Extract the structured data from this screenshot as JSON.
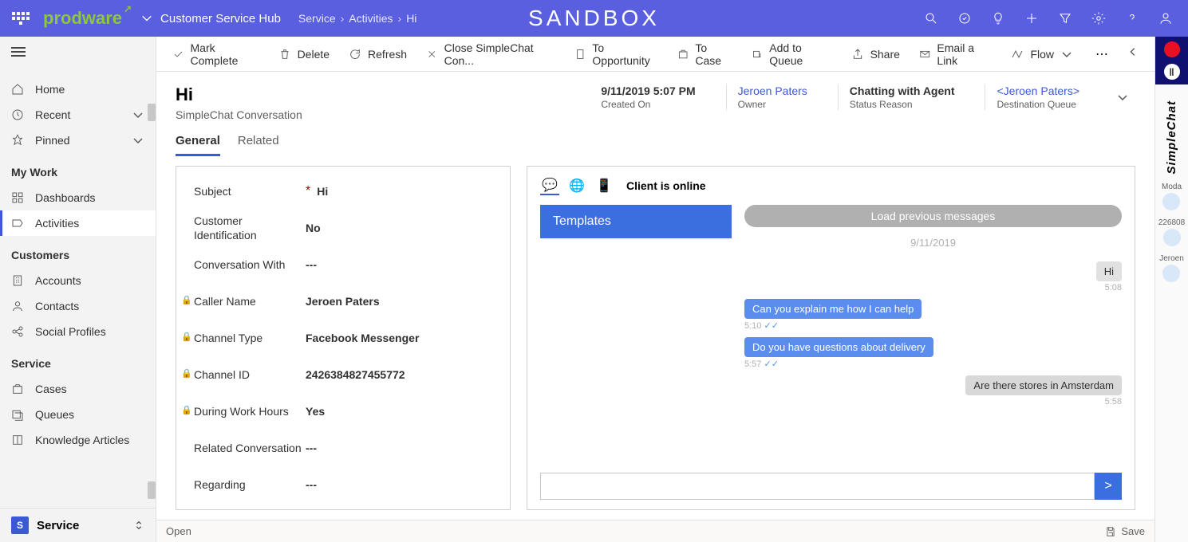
{
  "topbar": {
    "logo": "prodware",
    "hub": "Customer Service Hub",
    "breadcrumb": [
      "Service",
      "Activities",
      "Hi"
    ],
    "center": "SANDBOX"
  },
  "sidebar": {
    "home": "Home",
    "recent": "Recent",
    "pinned": "Pinned",
    "sections": {
      "mywork": {
        "title": "My Work",
        "items": [
          "Dashboards",
          "Activities"
        ]
      },
      "customers": {
        "title": "Customers",
        "items": [
          "Accounts",
          "Contacts",
          "Social Profiles"
        ]
      },
      "service": {
        "title": "Service",
        "items": [
          "Cases",
          "Queues",
          "Knowledge Articles"
        ]
      }
    },
    "area": "Service"
  },
  "commands": {
    "markComplete": "Mark Complete",
    "delete": "Delete",
    "refresh": "Refresh",
    "closeChat": "Close SimpleChat Con...",
    "toOpportunity": "To Opportunity",
    "toCase": "To Case",
    "addToQueue": "Add to Queue",
    "share": "Share",
    "emailLink": "Email a Link",
    "flow": "Flow"
  },
  "record": {
    "title": "Hi",
    "subtitle": "SimpleChat Conversation",
    "headerFields": {
      "createdOn": {
        "value": "9/11/2019 5:07 PM",
        "label": "Created On"
      },
      "owner": {
        "value": "Jeroen Paters",
        "label": "Owner"
      },
      "statusReason": {
        "value": "Chatting with Agent",
        "label": "Status Reason"
      },
      "destQueue": {
        "value": "<Jeroen Paters>",
        "label": "Destination Queue"
      }
    },
    "tabs": {
      "general": "General",
      "related": "Related"
    }
  },
  "form": {
    "subject": {
      "label": "Subject",
      "value": "Hi"
    },
    "custId": {
      "label": "Customer Identification",
      "value": "No"
    },
    "convWith": {
      "label": "Conversation With",
      "value": "---"
    },
    "caller": {
      "label": "Caller Name",
      "value": "Jeroen Paters"
    },
    "channelType": {
      "label": "Channel Type",
      "value": "Facebook Messenger"
    },
    "channelId": {
      "label": "Channel ID",
      "value": "2426384827455772"
    },
    "workHours": {
      "label": "During Work Hours",
      "value": "Yes"
    },
    "relatedConv": {
      "label": "Related Conversation",
      "value": "---"
    },
    "regarding": {
      "label": "Regarding",
      "value": "---"
    }
  },
  "chat": {
    "status": "Client is online",
    "templatesTitle": "Templates",
    "loadPrev": "Load previous messages",
    "date": "9/11/2019",
    "messages": [
      {
        "side": "in",
        "text": "Hi",
        "time": "5:08"
      },
      {
        "side": "out",
        "text": "Can you explain me how I can help",
        "time": "5:10",
        "read": true
      },
      {
        "side": "out",
        "text": "Do you have questions about delivery",
        "time": "5:57",
        "read": true
      },
      {
        "side": "gray",
        "text": "Are there stores in Amsterdam",
        "time": "5:58"
      }
    ],
    "send": ">"
  },
  "statusbar": {
    "left": "Open",
    "save": "Save"
  },
  "rail": {
    "brand": "SimpleChat",
    "items": [
      {
        "label": "Moda"
      },
      {
        "label": "226808"
      },
      {
        "label": "Jeroen"
      }
    ]
  }
}
